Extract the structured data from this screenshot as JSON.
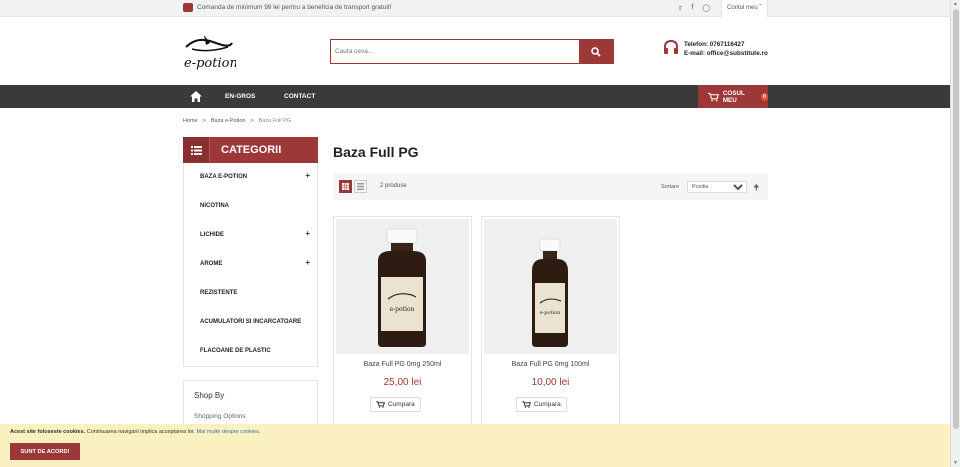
{
  "topbar": {
    "promo_text": "Comanda de minimum 99 lei pentru a beneficia de transport gratuit!",
    "social": [
      "twitter-icon",
      "facebook-icon",
      "instagram-icon"
    ],
    "account_label": "Contul meu"
  },
  "header": {
    "logo_text": "e-potion",
    "search_placeholder": "Cauta ceva...",
    "phone": "Telefon: 0767116427",
    "email": "E-mail: office@substitute.ro"
  },
  "nav": {
    "items": [
      "EN-GROS",
      "CONTACT"
    ],
    "cart_label": "COSUL MEU",
    "cart_count": "0"
  },
  "breadcrumb": [
    "Home",
    "Baza e-Potion",
    "Baza Full PG"
  ],
  "sidebar": {
    "title": "CATEGORII",
    "items": [
      {
        "label": "BAZA E-POTION",
        "expand": "+"
      },
      {
        "label": "NICOTINA",
        "expand": ""
      },
      {
        "label": "LICHIDE",
        "expand": "+"
      },
      {
        "label": "AROME",
        "expand": "+"
      },
      {
        "label": "REZISTENTE",
        "expand": ""
      },
      {
        "label": "ACUMULATORI SI INCARCATOARE",
        "expand": ""
      },
      {
        "label": "FLACOANE DE PLASTIC",
        "expand": ""
      }
    ],
    "shopby_title": "Shop By",
    "shopby_sub": "Shopping Options"
  },
  "main": {
    "title": "Baza Full PG",
    "count_text": "2 produse",
    "sort_label": "Sortare",
    "sort_value": "Pozitie",
    "products": [
      {
        "name": "Baza Full PG 0mg 250ml",
        "price": "25,00 lei",
        "buy": "Cumpara",
        "bottle_label": "e-potion"
      },
      {
        "name": "Baza Full PG 0mg 100ml",
        "price": "10,00 lei",
        "buy": "Cumpara",
        "bottle_label": "e-potion"
      }
    ]
  },
  "cookie": {
    "bold": "Acest site foloseste cookies.",
    "text": " Continuarea navigarii implica acceptarea lor.",
    "more": "Mai multe despre cookies.",
    "button": "SUNT DE ACORD!"
  },
  "colors": {
    "accent": "#9c3838",
    "nav_bg": "#3a3a3a",
    "cookie_bg": "#faf0c0"
  }
}
